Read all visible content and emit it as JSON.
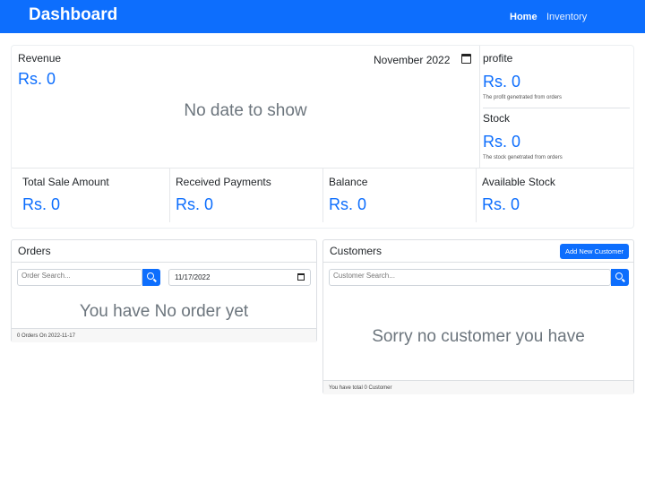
{
  "navbar": {
    "brand": "Dashboard",
    "links": [
      "Home",
      "Inventory"
    ],
    "active": "Home"
  },
  "colors": {
    "primary": "#0d6efd",
    "muted": "#6c757d"
  },
  "revenue": {
    "label": "Revenue",
    "value": "Rs. 0",
    "month": "November 2022",
    "empty": "No date to show"
  },
  "profit": {
    "label": "profite",
    "value": "Rs. 0",
    "note": "The profit genetrated from orders"
  },
  "stock": {
    "label": "Stock",
    "value": "Rs. 0",
    "note": "The stock genetrated from orders"
  },
  "summary": [
    {
      "label": "Total Sale Amount",
      "value": "Rs. 0"
    },
    {
      "label": "Received Payments",
      "value": "Rs. 0"
    },
    {
      "label": "Balance",
      "value": "Rs. 0"
    },
    {
      "label": "Available Stock",
      "value": "Rs. 0"
    }
  ],
  "orders": {
    "title": "Orders",
    "search_placeholder": "Order Search...",
    "date": "11/17/2022",
    "empty": "You have No order yet",
    "footer": "0 Orders On 2022-11-17"
  },
  "customers": {
    "title": "Customers",
    "add_button": "Add New Customer",
    "search_placeholder": "Customer Search...",
    "empty": "Sorry no customer you have",
    "footer": "You have total 0 Customer"
  }
}
